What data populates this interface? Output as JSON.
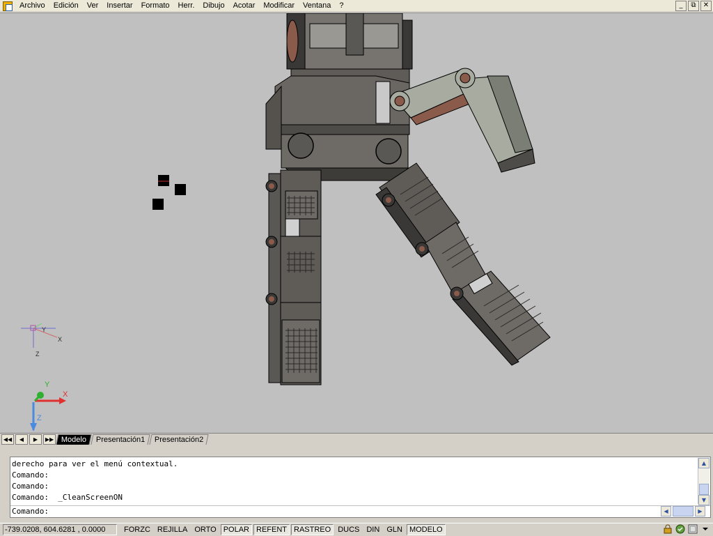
{
  "menubar": {
    "items": [
      "Archivo",
      "Edición",
      "Ver",
      "Insertar",
      "Formato",
      "Herr.",
      "Dibujo",
      "Acotar",
      "Modificar",
      "Ventana",
      "?"
    ],
    "window_controls": [
      "_",
      "⧉",
      "✕"
    ]
  },
  "viewport": {
    "ucs_small": {
      "y": "Y",
      "x": "X",
      "z": "Z"
    },
    "ucs_large": {
      "y": "Y",
      "x": "X",
      "z": "Z"
    },
    "colors": {
      "background": "#c0c0c0",
      "model_body": "#6e6b66",
      "model_dark": "#3e3c38",
      "model_light": "#a7aba0",
      "accent": "#8a5a4a"
    }
  },
  "tabs": {
    "nav": [
      "◀◀",
      "◀",
      "▶",
      "▶▶"
    ],
    "items": [
      {
        "label": "Modelo",
        "active": true
      },
      {
        "label": "Presentación1",
        "active": false
      },
      {
        "label": "Presentación2",
        "active": false
      }
    ]
  },
  "command": {
    "lines": [
      "derecho para ver el menú contextual.",
      "Comando:",
      "Comando:",
      "Comando:  _CleanScreenON"
    ],
    "prompt": "Comando:"
  },
  "statusbar": {
    "coords": "-739.0208, 604.6281 , 0.0000",
    "toggles": [
      {
        "label": "FORZC",
        "on": false
      },
      {
        "label": "REJILLA",
        "on": false
      },
      {
        "label": "ORTO",
        "on": false
      },
      {
        "label": "POLAR",
        "on": true
      },
      {
        "label": "REFENT",
        "on": true
      },
      {
        "label": "RASTREO",
        "on": true
      },
      {
        "label": "DUCS",
        "on": false
      },
      {
        "label": "DIN",
        "on": false
      },
      {
        "label": "GLN",
        "on": false
      },
      {
        "label": "MODELO",
        "on": true
      }
    ]
  }
}
